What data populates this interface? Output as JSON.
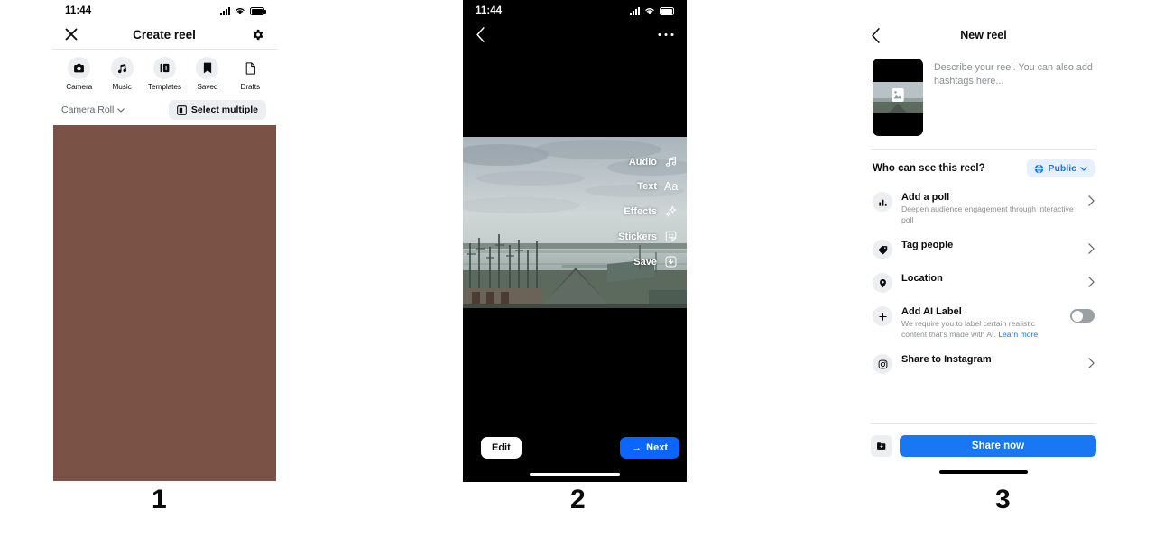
{
  "steps": [
    {
      "number": "1"
    },
    {
      "number": "2"
    },
    {
      "number": "3"
    }
  ],
  "panel1": {
    "status": {
      "time": "11:44",
      "signal_icon": "signal-bars-icon",
      "wifi_icon": "wifi-icon",
      "battery_icon": "battery-icon"
    },
    "header": {
      "close_icon": "close-icon",
      "title": "Create reel",
      "settings_icon": "gear-icon"
    },
    "tools": [
      {
        "label": "Camera",
        "icon": "camera-icon"
      },
      {
        "label": "Music",
        "icon": "music-note-icon"
      },
      {
        "label": "Templates",
        "icon": "templates-icon"
      },
      {
        "label": "Saved",
        "icon": "bookmark-icon"
      },
      {
        "label": "Drafts",
        "icon": "document-icon"
      }
    ],
    "roll": {
      "label": "Camera Roll",
      "chevron_icon": "chevron-down-icon",
      "select_multiple": "Select multiple",
      "select_multiple_icon": "multi-select-icon"
    },
    "photo_color": "#7a5246"
  },
  "panel2": {
    "status": {
      "time": "11:44",
      "signal_icon": "signal-bars-icon",
      "wifi_icon": "wifi-icon",
      "battery_icon": "battery-icon"
    },
    "topbar": {
      "back_icon": "chevron-left-icon",
      "more_icon": "more-horizontal-icon"
    },
    "tools": [
      {
        "label": "Audio",
        "icon": "music-note-icon"
      },
      {
        "label": "Text",
        "icon": "text-aa-icon"
      },
      {
        "label": "Effects",
        "icon": "sparkles-icon"
      },
      {
        "label": "Stickers",
        "icon": "sticker-smiley-icon"
      },
      {
        "label": "Save",
        "icon": "download-icon"
      }
    ],
    "edit_label": "Edit",
    "next_label": "Next",
    "next_arrow": "→",
    "next_color": "#0a66ff"
  },
  "panel3": {
    "header": {
      "back_icon": "chevron-left-icon",
      "title": "New reel"
    },
    "compose": {
      "thumb_icon": "image-placeholder-icon",
      "placeholder": "Describe your reel. You can also add hashtags here..."
    },
    "audience": {
      "question": "Who can see this reel?",
      "value": "Public",
      "globe_icon": "globe-icon",
      "chevron_icon": "chevron-down-icon",
      "pill_color": "#1877f2"
    },
    "options": [
      {
        "title": "Add a poll",
        "subtitle": "Deepen audience engagement through interactive poll",
        "icon": "bar-chart-icon",
        "accessory": "chevron"
      },
      {
        "title": "Tag people",
        "subtitle": "",
        "icon": "tag-icon",
        "accessory": "chevron"
      },
      {
        "title": "Location",
        "subtitle": "",
        "icon": "location-pin-icon",
        "accessory": "chevron"
      },
      {
        "title": "Add AI Label",
        "subtitle": "We require you to label certain realistic content that's made with AI. ",
        "subtitle_link": "Learn more",
        "icon": "plus-icon",
        "accessory": "toggle",
        "toggle_on": false
      },
      {
        "title": "Share to Instagram",
        "subtitle": "",
        "icon": "instagram-icon",
        "accessory": "chevron"
      }
    ],
    "footer": {
      "draft_icon": "save-draft-icon",
      "share_label": "Share now",
      "share_color": "#1877f2"
    }
  }
}
